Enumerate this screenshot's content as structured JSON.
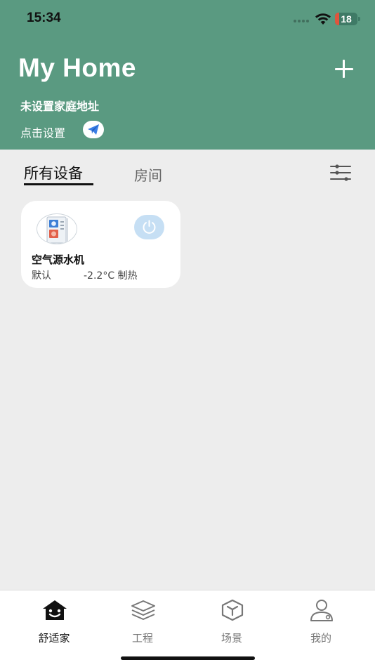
{
  "status_bar": {
    "time": "15:34",
    "battery_level": "18",
    "battery_fraction": 0.18
  },
  "header": {
    "title": "My Home",
    "address_text": "未设置家庭地址",
    "set_link": "点击设置"
  },
  "tabs": {
    "all_devices": "所有设备",
    "rooms": "房间"
  },
  "device": {
    "name": "空气源水机",
    "room": "默认",
    "status": "-2.2°C 制热"
  },
  "bottom_nav": {
    "items": [
      {
        "label": "舒适家",
        "icon": "home-icon",
        "active": true
      },
      {
        "label": "工程",
        "icon": "layers-icon",
        "active": false
      },
      {
        "label": "场景",
        "icon": "cube-icon",
        "active": false
      },
      {
        "label": "我的",
        "icon": "profile-icon",
        "active": false
      }
    ]
  },
  "colors": {
    "header_bg": "#5a9a81",
    "page_bg": "#ededed",
    "power_button_bg": "#c6dff4",
    "battery_low": "#e0553d"
  }
}
